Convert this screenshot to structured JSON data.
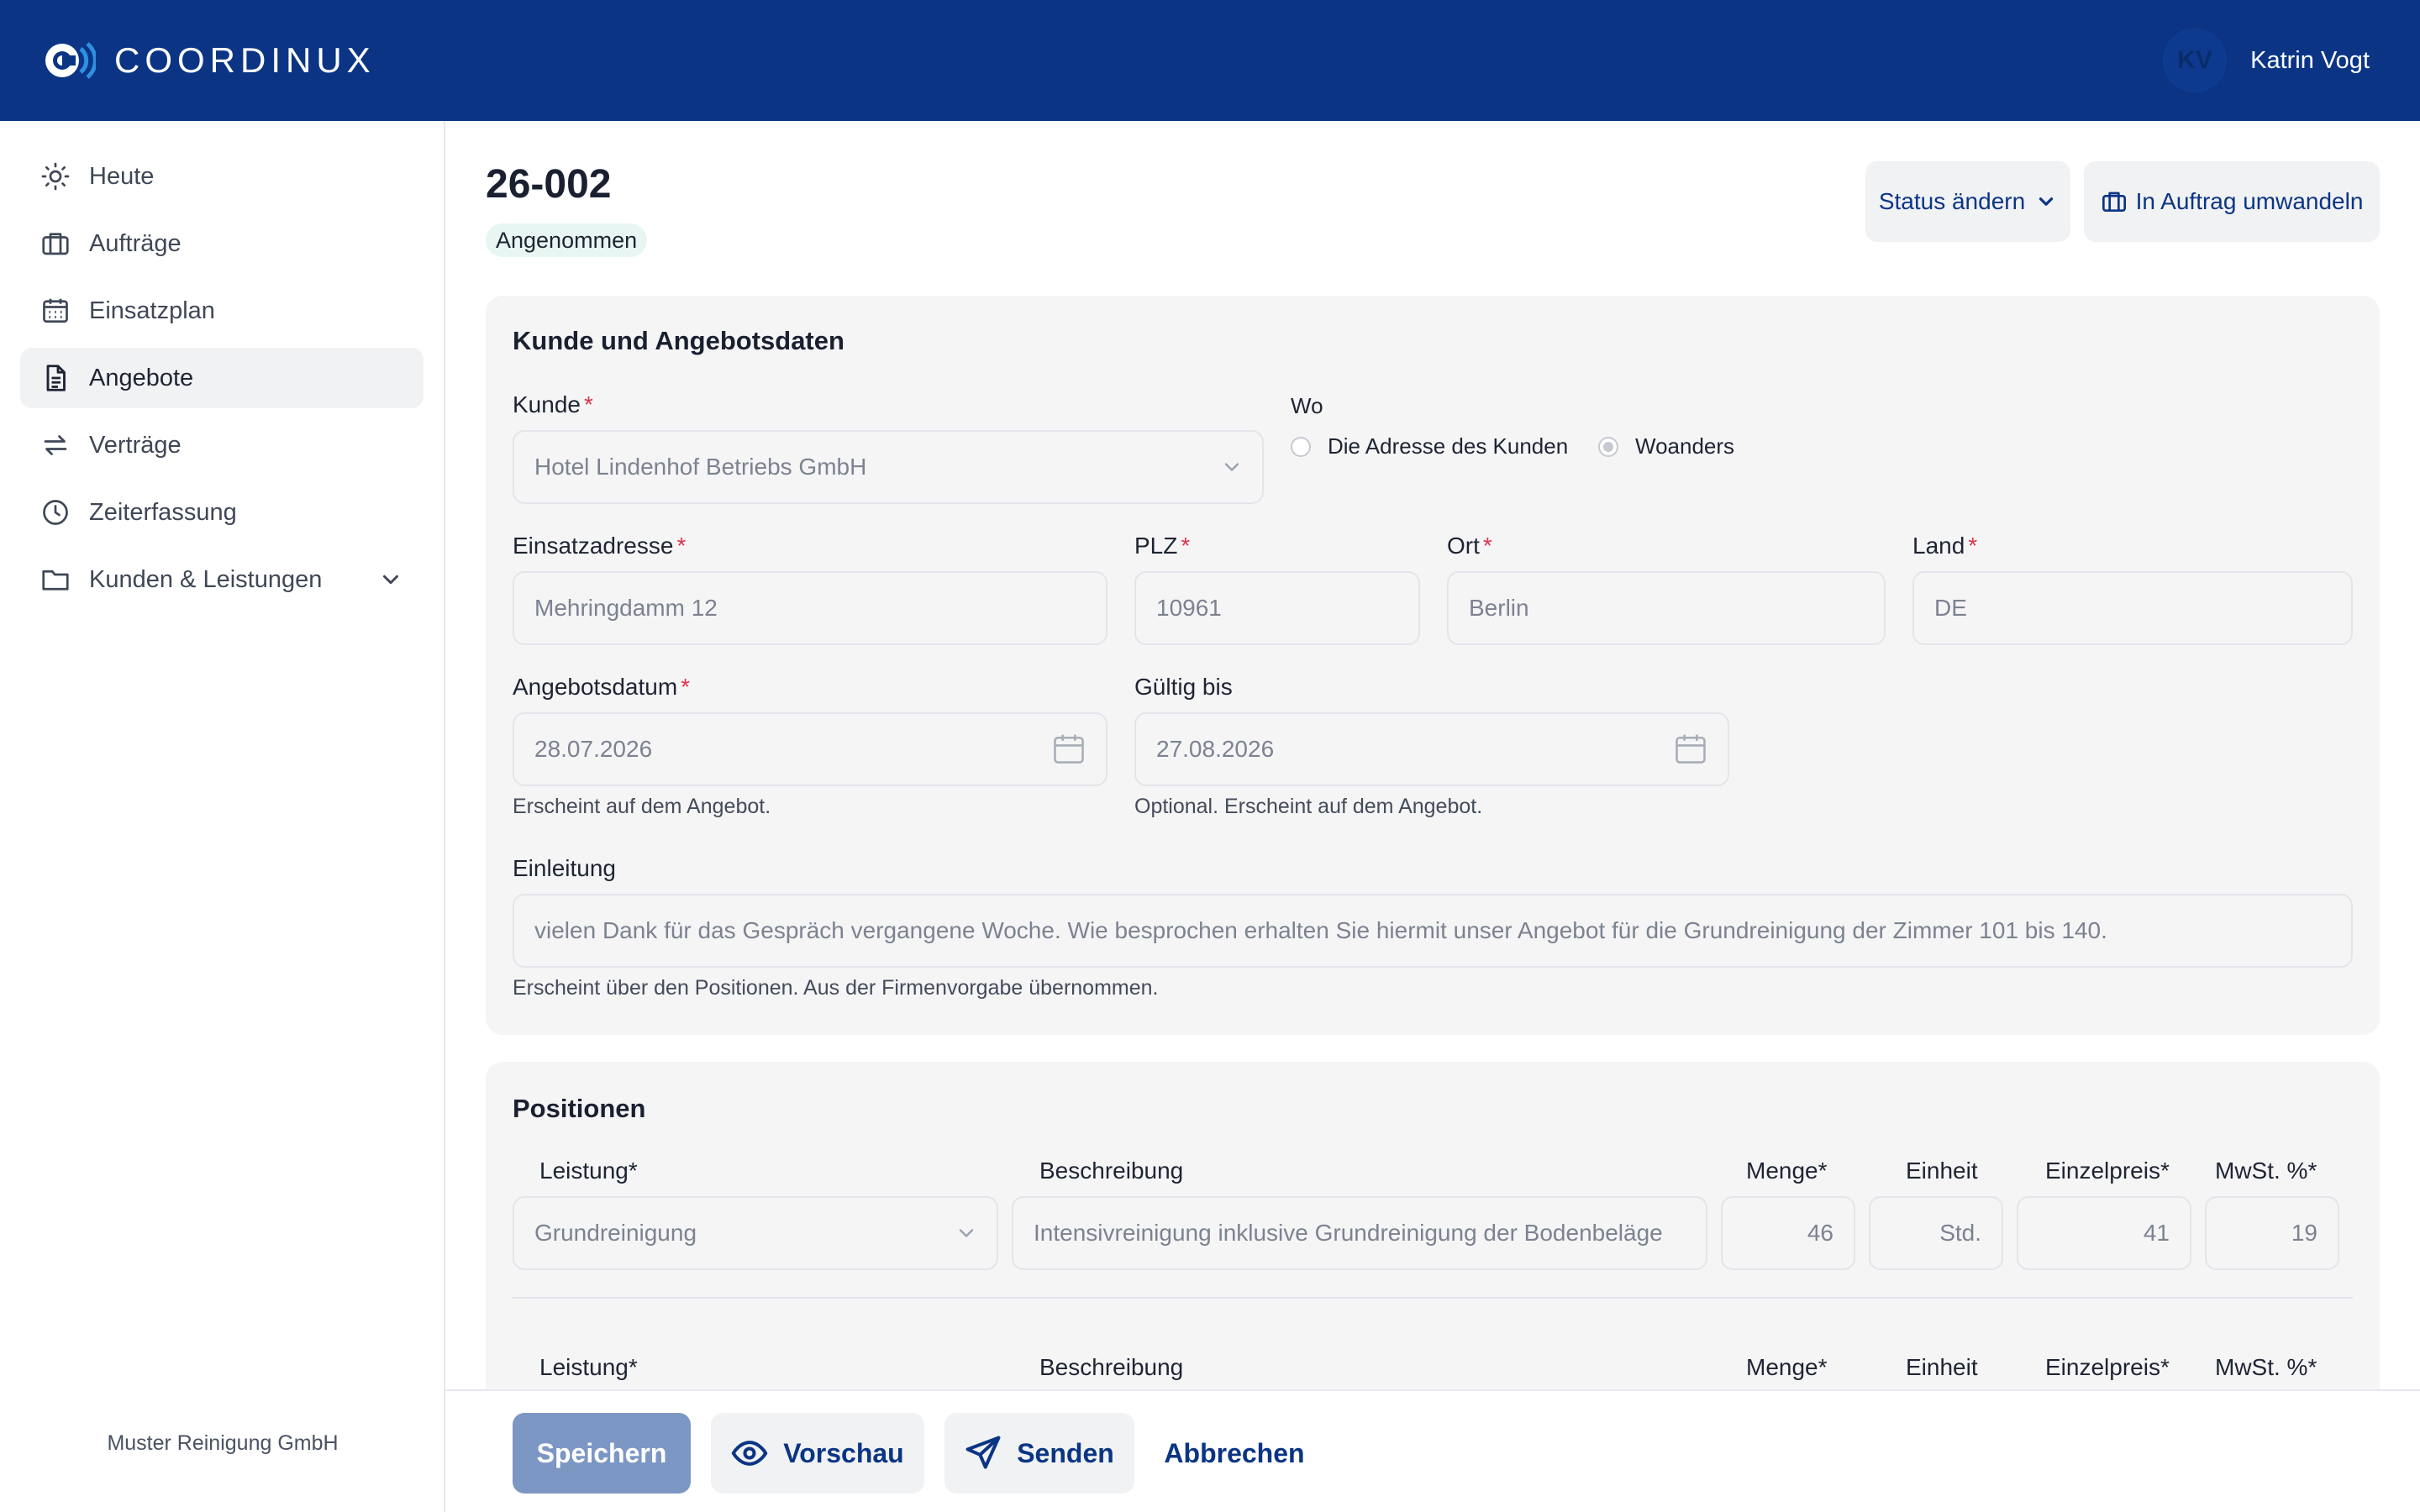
{
  "app": {
    "name": "COORDINUX"
  },
  "user": {
    "initials": "KV",
    "name": "Katrin Vogt"
  },
  "sidebar": {
    "items": [
      {
        "label": "Heute",
        "icon": "sun-icon"
      },
      {
        "label": "Aufträge",
        "icon": "briefcase-icon"
      },
      {
        "label": "Einsatzplan",
        "icon": "calendar-icon"
      },
      {
        "label": "Angebote",
        "icon": "document-icon",
        "active": true
      },
      {
        "label": "Verträge",
        "icon": "arrows-exchange-icon"
      },
      {
        "label": "Zeiterfassung",
        "icon": "clock-icon"
      },
      {
        "label": "Kunden & Leistungen",
        "icon": "folder-icon",
        "expandable": true
      }
    ],
    "company": "Muster Reinigung GmbH"
  },
  "header": {
    "title": "26-002",
    "status": "Angenommen",
    "status_button": "Status ändern",
    "convert_button": "In Auftrag umwandeln"
  },
  "customer_section": {
    "title": "Kunde und Angebotsdaten",
    "customer_label": "Kunde",
    "customer_value": "Hotel Lindenhof Betriebs GmbH",
    "where_label": "Wo",
    "where_options": [
      "Die Adresse des Kunden",
      "Woanders"
    ],
    "where_selected": "Woanders",
    "address_label": "Einsatzadresse",
    "address_value": "Mehringdamm 12",
    "zip_label": "PLZ",
    "zip_value": "10961",
    "city_label": "Ort",
    "city_value": "Berlin",
    "country_label": "Land",
    "country_value": "DE",
    "offer_date_label": "Angebotsdatum",
    "offer_date_value": "28.07.2026",
    "offer_date_hint": "Erscheint auf dem Angebot.",
    "valid_until_label": "Gültig bis",
    "valid_until_value": "27.08.2026",
    "valid_until_hint": "Optional. Erscheint auf dem Angebot.",
    "intro_label": "Einleitung",
    "intro_value": "vielen Dank für das Gespräch vergangene Woche. Wie besprochen erhalten Sie hiermit unser Angebot für die Grundreinigung der Zimmer 101 bis 140.",
    "intro_hint": "Erscheint über den Positionen. Aus der Firmenvorgabe übernommen."
  },
  "positions_section": {
    "title": "Positionen",
    "columns": {
      "service": "Leistung*",
      "description": "Beschreibung",
      "quantity": "Menge*",
      "unit": "Einheit",
      "unit_price": "Einzelpreis*",
      "vat": "MwSt. %*"
    },
    "rows": [
      {
        "service": "Grundreinigung",
        "description": "Intensivreinigung inklusive Grundreinigung der Bodenbeläge",
        "quantity": "46",
        "unit": "Std.",
        "unit_price": "41",
        "vat": "19"
      }
    ]
  },
  "footer": {
    "save": "Speichern",
    "preview": "Vorschau",
    "send": "Senden",
    "cancel": "Abbrechen"
  },
  "colors": {
    "primary": "#0b3584",
    "save_disabled": "#7d97c4",
    "required": "#e0334a",
    "badge_bg": "#e7f6f2"
  }
}
